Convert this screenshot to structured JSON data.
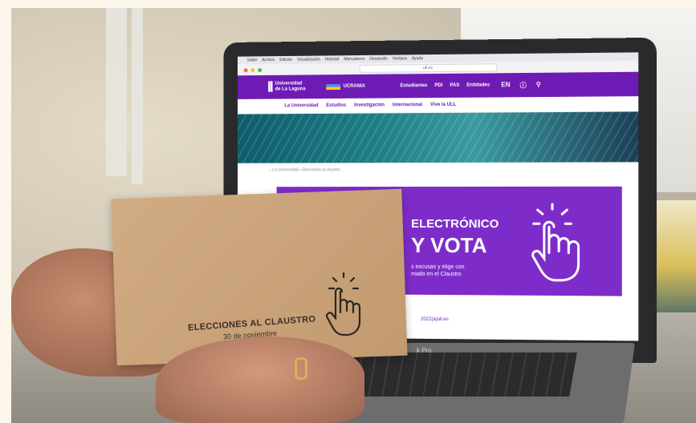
{
  "site": {
    "menubar": [
      "Safari",
      "Archivo",
      "Edición",
      "Visualización",
      "Historial",
      "Marcadores",
      "Desarrollo",
      "Ventana",
      "Ayuda"
    ],
    "url": "ull.es",
    "logo_mark": "ll",
    "logo_line1": "Universidad",
    "logo_line2": "de La Laguna",
    "ukraine_label": "UCRANIA",
    "topnav": [
      "Estudiantes",
      "PDI",
      "PAS",
      "Entidades"
    ],
    "lang": "EN",
    "subnav": [
      "La Universidad",
      "Estudios",
      "Investigación",
      "Internacional",
      "Vive la ULL"
    ],
    "breadcrumb": "⌂  La Universidad  ›  Elecciones al claustro",
    "banner_line1": "ELECTRÓNICO",
    "banner_line2": "Y VOTA",
    "banner_line3a": "s excusas y elige con",
    "banner_line3b": "mado en el Claustro",
    "link": "2022(a)ull.es"
  },
  "laptop_brand": "k Pro",
  "envelope": {
    "title": "ELECCIONES AL CLAUSTRO",
    "date": "30 de noviembre"
  },
  "colors": {
    "brand_purple": "#6e1bb5",
    "envelope": "#c9a27a"
  }
}
